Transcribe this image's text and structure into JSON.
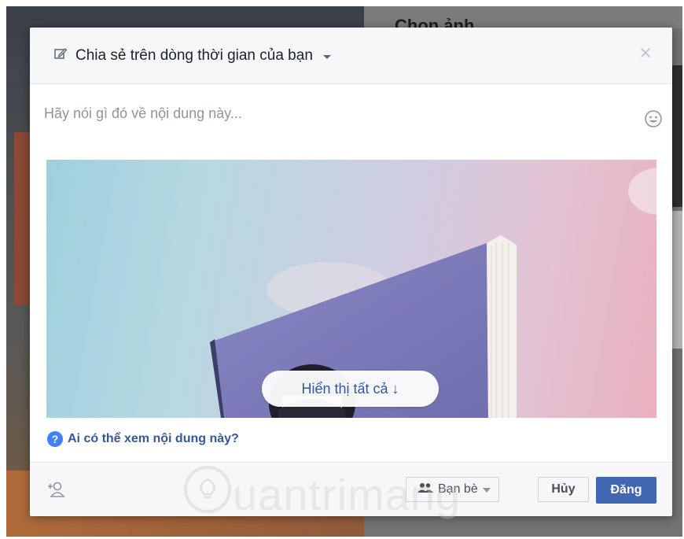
{
  "background": {
    "heading": "Chọn ảnh"
  },
  "dialog": {
    "header": {
      "title": "Chia sẻ trên dòng thời gian của bạn"
    },
    "composer": {
      "placeholder": "Hãy nói gì đó về nội dung này..."
    },
    "preview": {
      "show_all_label": "Hiển thị tất cả ↓"
    },
    "privacy_help": {
      "label": "Ai có thể xem nội dung này?"
    },
    "footer": {
      "audience_label": "Bạn bè",
      "cancel_label": "Hủy",
      "post_label": "Đăng"
    }
  },
  "watermark": {
    "text": "uantrimang"
  },
  "colors": {
    "accent": "#4267b2",
    "link": "#365899",
    "help_icon": "#4080ff"
  },
  "icons": [
    "pencil-icon",
    "chevron-down-icon",
    "close-icon",
    "emoji-icon",
    "question-icon",
    "tag-friends-icon",
    "friends-icon",
    "lightbulb-icon"
  ]
}
